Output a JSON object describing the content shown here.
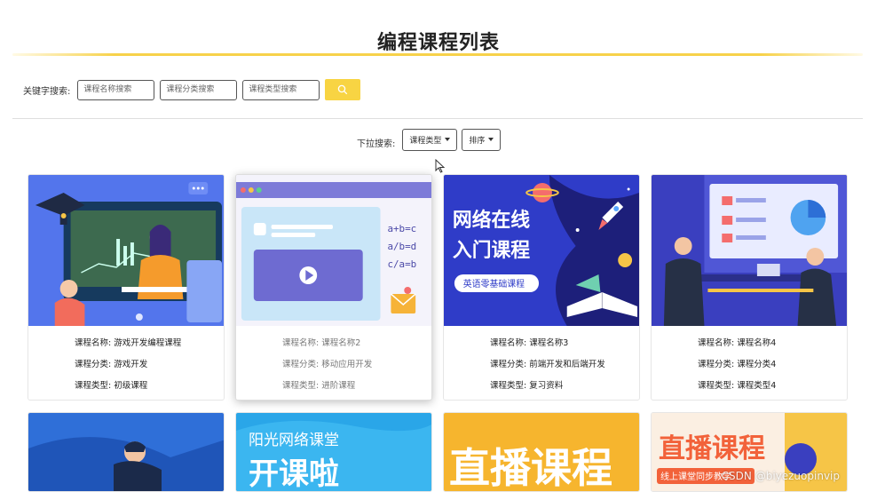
{
  "page": {
    "title": "编程课程列表"
  },
  "search": {
    "label": "关键字搜索:",
    "name_placeholder": "课程名称搜索",
    "category_placeholder": "课程分类搜索",
    "type_placeholder": "课程类型搜索"
  },
  "filters": {
    "label": "下拉搜索:",
    "type_label": "课程类型",
    "sort_label": "排序"
  },
  "courses": [
    {
      "name": "课程名称: 游戏开发编程课程",
      "category": "课程分类: 游戏开发",
      "type": "课程类型: 初级课程"
    },
    {
      "name": "课程名称: 课程名称2",
      "category": "课程分类: 移动应用开发",
      "type": "课程类型: 进阶课程"
    },
    {
      "name": "课程名称: 课程名称3",
      "category": "课程分类: 前端开发和后端开发",
      "type": "课程类型: 复习资料",
      "banner": {
        "line1": "网络在线",
        "line2": "入门课程",
        "tag": "英语零基础课程"
      }
    },
    {
      "name": "课程名称: 课程名称4",
      "category": "课程分类: 课程分类4",
      "type": "课程类型: 课程类型4"
    }
  ],
  "second_row": {
    "card2_text1": "阳光网络课堂",
    "card2_text2": "开课啦",
    "card3_text": "直播课程",
    "card4_text1": "直播课程",
    "card4_text2": "线上课堂同步教学"
  },
  "card2_formula": [
    "a+b=c",
    "a/b=d",
    "c/a=b"
  ],
  "watermark": "CSDN @biyezuopinvip",
  "colors": {
    "accent": "#f8d443",
    "title_line": "#f7d24a"
  }
}
